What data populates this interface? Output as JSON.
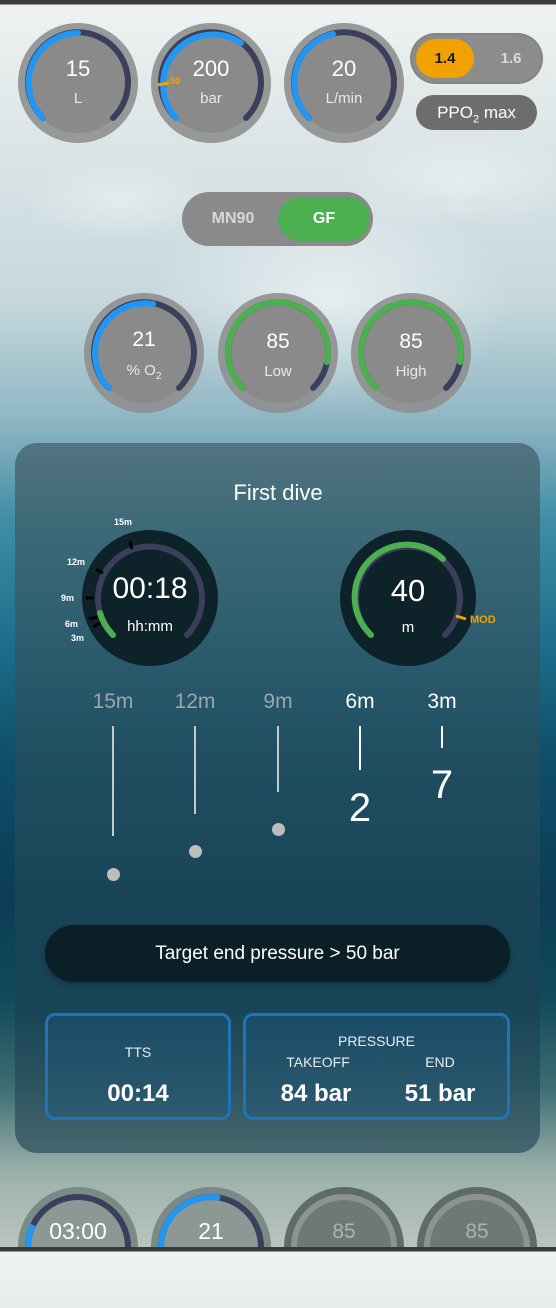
{
  "top_gauges": [
    {
      "value": "15",
      "unit": "L",
      "fraction": 0.5
    },
    {
      "value": "200",
      "unit": "bar",
      "fraction": 0.6,
      "marker": "50"
    },
    {
      "value": "20",
      "unit": "L/min",
      "fraction": 0.4
    }
  ],
  "ppo2": {
    "option_a": "1.4",
    "option_b": "1.6",
    "selected": "1.4",
    "label_main": "PPO",
    "label_sub": "2",
    "label_rest": " max"
  },
  "algorithm": {
    "option_a": "MN90",
    "option_b": "GF",
    "selected": "GF"
  },
  "gas_gauges": [
    {
      "value": "21",
      "unit_main": "% O",
      "unit_sub": "2",
      "fraction": 0.35
    },
    {
      "value": "85",
      "unit": "Low",
      "fraction": 0.85
    },
    {
      "value": "85",
      "unit": "High",
      "fraction": 0.85
    }
  ],
  "dive": {
    "title": "First dive",
    "time_gauge": {
      "value": "00:18",
      "unit": "hh:mm",
      "ticks": [
        "15m",
        "12m",
        "9m",
        "6m",
        "3m"
      ]
    },
    "depth_gauge": {
      "value": "40",
      "unit": "m",
      "marker": "MOD",
      "fraction": 0.62
    },
    "stops": [
      {
        "depth": "15m",
        "minutes": ""
      },
      {
        "depth": "12m",
        "minutes": ""
      },
      {
        "depth": "9m",
        "minutes": ""
      },
      {
        "depth": "6m",
        "minutes": "2"
      },
      {
        "depth": "3m",
        "minutes": "7"
      }
    ],
    "target": "Target end pressure > 50 bar",
    "tts": {
      "label": "TTS",
      "value": "00:14"
    },
    "pressure": {
      "label": "PRESSURE",
      "takeoff_label": "TAKEOFF",
      "takeoff_value": "84 bar",
      "end_label": "END",
      "end_value": "51 bar"
    }
  },
  "bottom_gauges": [
    {
      "value": "03:00"
    },
    {
      "value": "21"
    },
    {
      "value": "85"
    },
    {
      "value": "85"
    }
  ],
  "colors": {
    "blue": "#2196f3",
    "green": "#4caf50",
    "orange": "#f2a200",
    "track": "#3b3f5c"
  }
}
